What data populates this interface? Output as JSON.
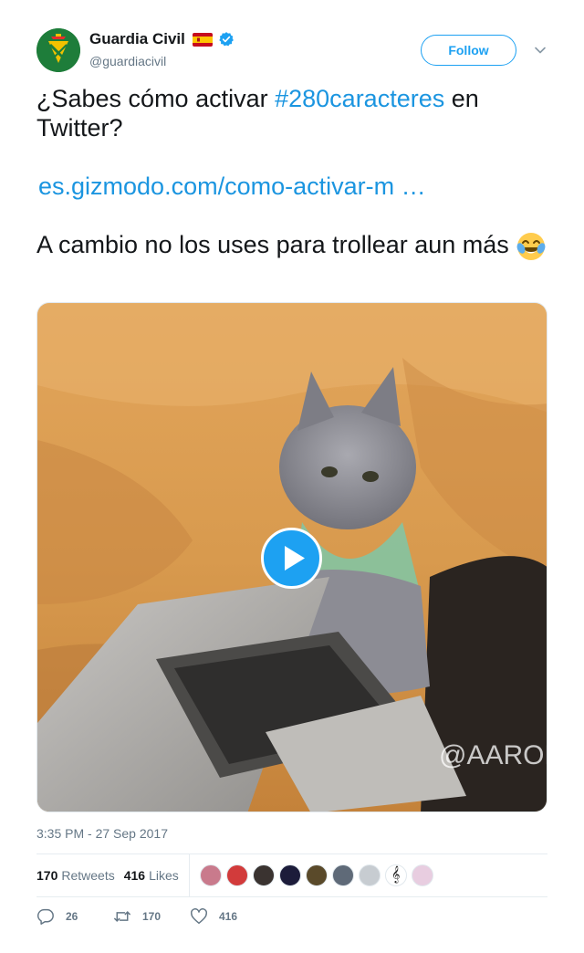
{
  "author": {
    "display_name": "Guardia Civil",
    "handle": "@guardiacivil",
    "verified": true,
    "flag": "spain-flag",
    "avatar": "guardia-civil-emblem"
  },
  "follow_label": "Follow",
  "tweet": {
    "text_before": "¿Sabes cómo activar ",
    "hashtag": "#280caracteres",
    "text_after": " en Twitter?",
    "link": "es.gizmodo.com/como-activar-m",
    "link_ellipsis": " …",
    "text_line2": "A cambio no los uses para trollear aun más ",
    "emoji": "face-with-tears-of-joy"
  },
  "media": {
    "type": "video",
    "watermark": "@AARON",
    "description_icon": "play-icon"
  },
  "timestamp": "3:35 PM - 27 Sep 2017",
  "stats": {
    "retweets_count": "170",
    "retweets_label": "Retweets",
    "likes_count": "416",
    "likes_label": "Likes"
  },
  "likers_count": 9,
  "actions": {
    "reply_count": "26",
    "retweet_count": "170",
    "like_count": "416"
  },
  "colors": {
    "accent": "#1da1f2",
    "link": "#1b95e0",
    "secondary_text": "#657786",
    "avatar_bg": "#1e7d3a"
  }
}
